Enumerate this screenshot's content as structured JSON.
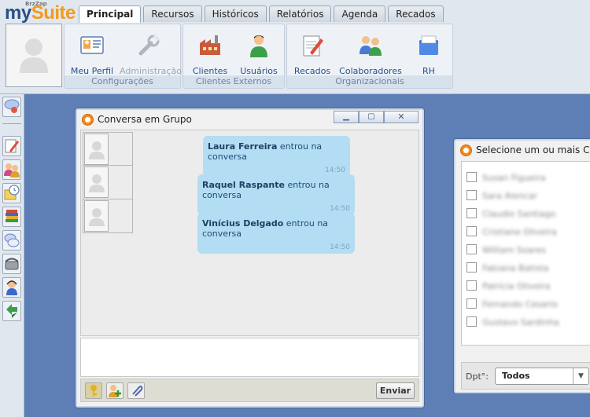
{
  "app": {
    "logo_small": "BrzZap",
    "logo_my": "my",
    "logo_suite": "Suite"
  },
  "tabs": [
    "Principal",
    "Recursos",
    "Históricos",
    "Relatórios",
    "Agenda",
    "Recados"
  ],
  "ribbon": {
    "groups": [
      {
        "label": "Configurações",
        "items": [
          {
            "label": "Meu Perfil",
            "icon": "profile-card-icon",
            "disabled": false
          },
          {
            "label": "Administração",
            "icon": "wrench-icon",
            "disabled": true
          }
        ]
      },
      {
        "label": "Clientes Externos",
        "items": [
          {
            "label": "Clientes",
            "icon": "factory-icon",
            "disabled": false
          },
          {
            "label": "Usuários",
            "icon": "user-icon",
            "disabled": false
          }
        ]
      },
      {
        "label": "Organizacionais",
        "items": [
          {
            "label": "Recados",
            "icon": "notepad-icon",
            "disabled": false
          },
          {
            "label": "Colaboradores",
            "icon": "users-icon",
            "disabled": false
          },
          {
            "label": "RH",
            "icon": "folder-icon",
            "disabled": false
          }
        ]
      }
    ]
  },
  "chat": {
    "title": "Conversa em Grupo",
    "messages": [
      {
        "name": "Laura Ferreira",
        "text": "entrou na conversa",
        "time": "14:50"
      },
      {
        "name": "Raquel Raspante",
        "text": "entrou na conversa",
        "time": "14:50"
      },
      {
        "name": "Vinícius Delgado",
        "text": "entrou na conversa",
        "time": "14:50"
      }
    ],
    "send_label": "Enviar"
  },
  "collab": {
    "title": "Selecione um ou mais Colab",
    "names": [
      "Susan Figueira",
      "Sara Alencar",
      "Claudio Santiago",
      "Cristiane Oliveira",
      "William Soares",
      "Fabiana Batista",
      "Patricia Oliveira",
      "Fernando Cesario",
      "Gustavo Sardinha"
    ],
    "dept_label": "Dpt°:",
    "dept_value": "Todos"
  },
  "colors": {
    "accent": "#2a4f87",
    "logo_orange": "#f29b1c",
    "desktop": "#5d7fb6",
    "bubble": "#b3ddf2"
  }
}
